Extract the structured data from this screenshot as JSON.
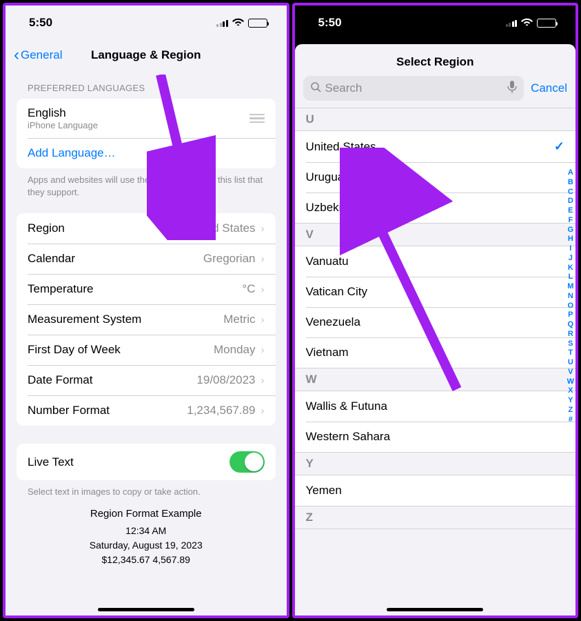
{
  "left": {
    "status": {
      "time": "5:50",
      "battery": "29"
    },
    "nav": {
      "back": "General",
      "title": "Language & Region"
    },
    "pref_lang_header": "PREFERRED LANGUAGES",
    "english": {
      "name": "English",
      "sub": "iPhone Language"
    },
    "add_language": "Add Language…",
    "pref_lang_footer": "Apps and websites will use the first language in this list that they support.",
    "rows": {
      "region": {
        "label": "Region",
        "value": "United States"
      },
      "calendar": {
        "label": "Calendar",
        "value": "Gregorian"
      },
      "temperature": {
        "label": "Temperature",
        "value": "°C"
      },
      "measurement": {
        "label": "Measurement System",
        "value": "Metric"
      },
      "first_day": {
        "label": "First Day of Week",
        "value": "Monday"
      },
      "date_format": {
        "label": "Date Format",
        "value": "19/08/2023"
      },
      "number_format": {
        "label": "Number Format",
        "value": "1,234,567.89"
      }
    },
    "live_text": "Live Text",
    "live_text_footer": "Select text in images to copy or take action.",
    "example": {
      "title": "Region Format Example",
      "time": "12:34 AM",
      "date": "Saturday, August 19, 2023",
      "numbers": "$12,345.67   4,567.89"
    }
  },
  "right": {
    "status": {
      "time": "5:50",
      "battery": "29"
    },
    "sheet_title": "Select Region",
    "search_placeholder": "Search",
    "cancel": "Cancel",
    "sections": {
      "U": [
        "United States",
        "Uruguay",
        "Uzbekistan"
      ],
      "V": [
        "Vanuatu",
        "Vatican City",
        "Venezuela",
        "Vietnam"
      ],
      "W": [
        "Wallis & Futuna",
        "Western Sahara"
      ],
      "Y": [
        "Yemen"
      ],
      "Z": []
    },
    "selected": "United States",
    "index": [
      "A",
      "B",
      "C",
      "D",
      "E",
      "F",
      "G",
      "H",
      "I",
      "J",
      "K",
      "L",
      "M",
      "N",
      "O",
      "P",
      "Q",
      "R",
      "S",
      "T",
      "U",
      "V",
      "W",
      "X",
      "Y",
      "Z",
      "#"
    ]
  }
}
